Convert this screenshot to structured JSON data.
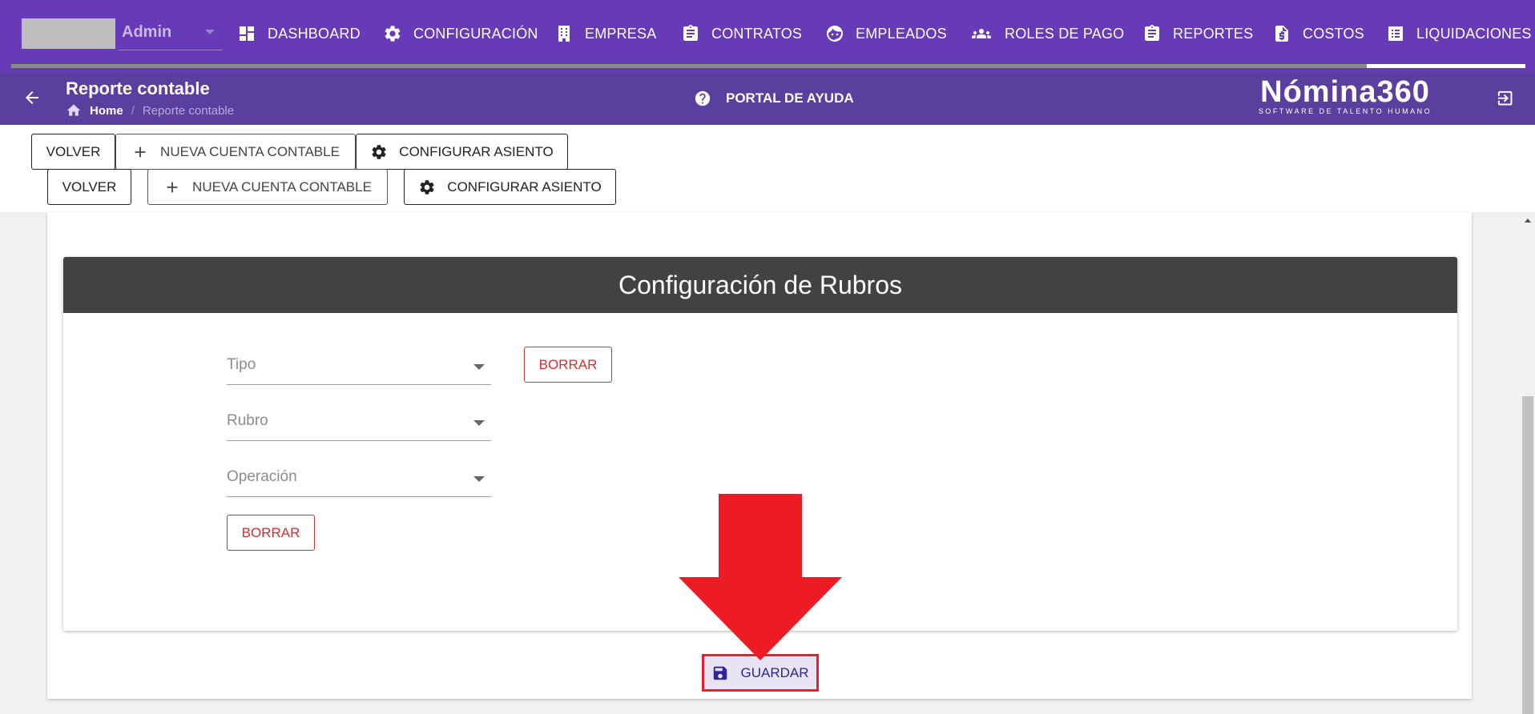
{
  "topnav": {
    "user": "Admin",
    "items": [
      {
        "label": "DASHBOARD",
        "icon": "dashboard-icon"
      },
      {
        "label": "CONFIGURACIÓN",
        "icon": "gear-icon"
      },
      {
        "label": "EMPRESA",
        "icon": "building-icon"
      },
      {
        "label": "CONTRATOS",
        "icon": "clipboard-icon"
      },
      {
        "label": "EMPLEADOS",
        "icon": "face-icon"
      },
      {
        "label": "ROLES DE PAGO",
        "icon": "people-icon"
      },
      {
        "label": "REPORTES",
        "icon": "clipboard-icon"
      },
      {
        "label": "COSTOS",
        "icon": "invoice-dollar-icon"
      },
      {
        "label": "LIQUIDACIONES",
        "icon": "list-icon"
      }
    ],
    "active_item": "LIQUIDACIONES"
  },
  "subheader": {
    "title": "Reporte contable",
    "breadcrumb": {
      "home": "Home",
      "separator": "/",
      "current": "Reporte contable"
    },
    "help": "PORTAL DE AYUDA",
    "logo": {
      "name": "Nómina360",
      "tagline": "SOFTWARE DE TALENTO HUMANO"
    }
  },
  "toolbar": {
    "back": "VOLVER",
    "new_account": "NUEVA CUENTA CONTABLE",
    "configure": "CONFIGURAR ASIENTO"
  },
  "card": {
    "title": "Configuración de Rubros",
    "fields": {
      "tipo": "Tipo",
      "rubro": "Rubro",
      "operacion": "Operación"
    },
    "delete_label": "BORRAR"
  },
  "save_label": "GUARDAR",
  "colors": {
    "nav": "#673ab7",
    "subheader": "#5b3f9e",
    "card_header": "#424242",
    "danger": "#d32f2f",
    "annotation": "#e8202a"
  }
}
